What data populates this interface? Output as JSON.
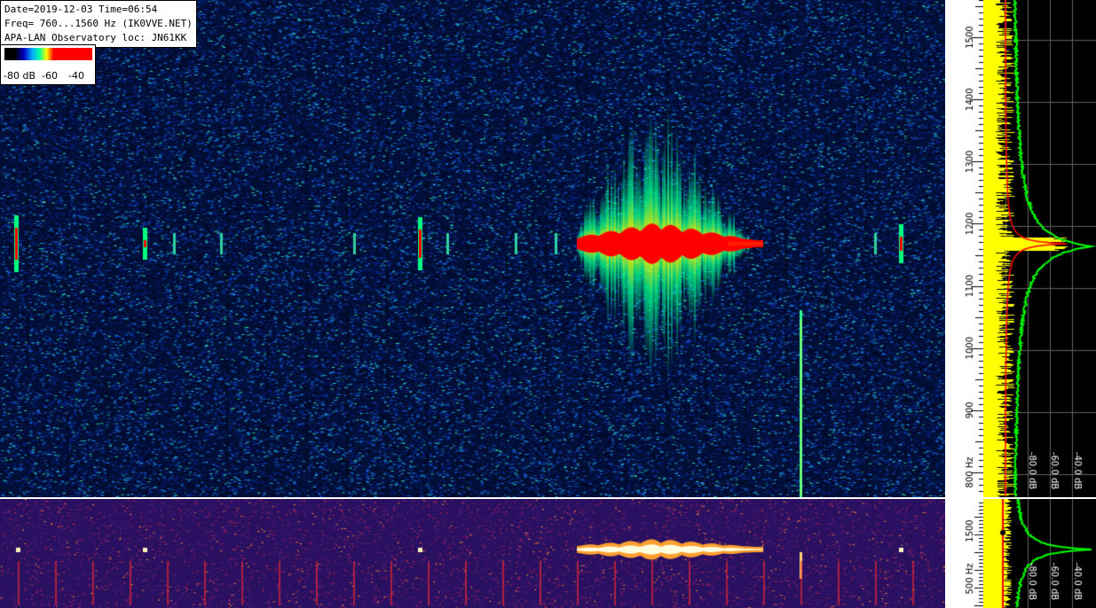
{
  "header": {
    "line1": "Date=2019-12-03 Time=06:54",
    "line2": "Freq= 760...1560 Hz (IK0VVE.NET)",
    "line3": "APA-LAN Observatory loc: JN61KK"
  },
  "legend": {
    "label_80": "-80 dB",
    "label_60": "-60",
    "label_40": "-40"
  },
  "freq_axis": {
    "ticks": [
      "1500",
      "1400",
      "1300",
      "1200",
      "1100",
      "1000",
      "900",
      "800 Hz"
    ],
    "tick_values_hz": [
      1500,
      1400,
      1300,
      1200,
      1100,
      1000,
      900,
      800
    ],
    "range_hz": [
      760,
      1560
    ]
  },
  "lower_axis": {
    "ticks": [
      "1500",
      "500 Hz"
    ]
  },
  "spectrum_db_labels": [
    "-80.0 dB",
    "-60.0 dB",
    "-40.0 dB"
  ],
  "colors": {
    "peak": "#ff0000",
    "spectrum_avg": "#00ff00",
    "spectrum_inst": "#ffff00",
    "marker": "#ff0000",
    "lower_bg": "#2a1060"
  }
}
